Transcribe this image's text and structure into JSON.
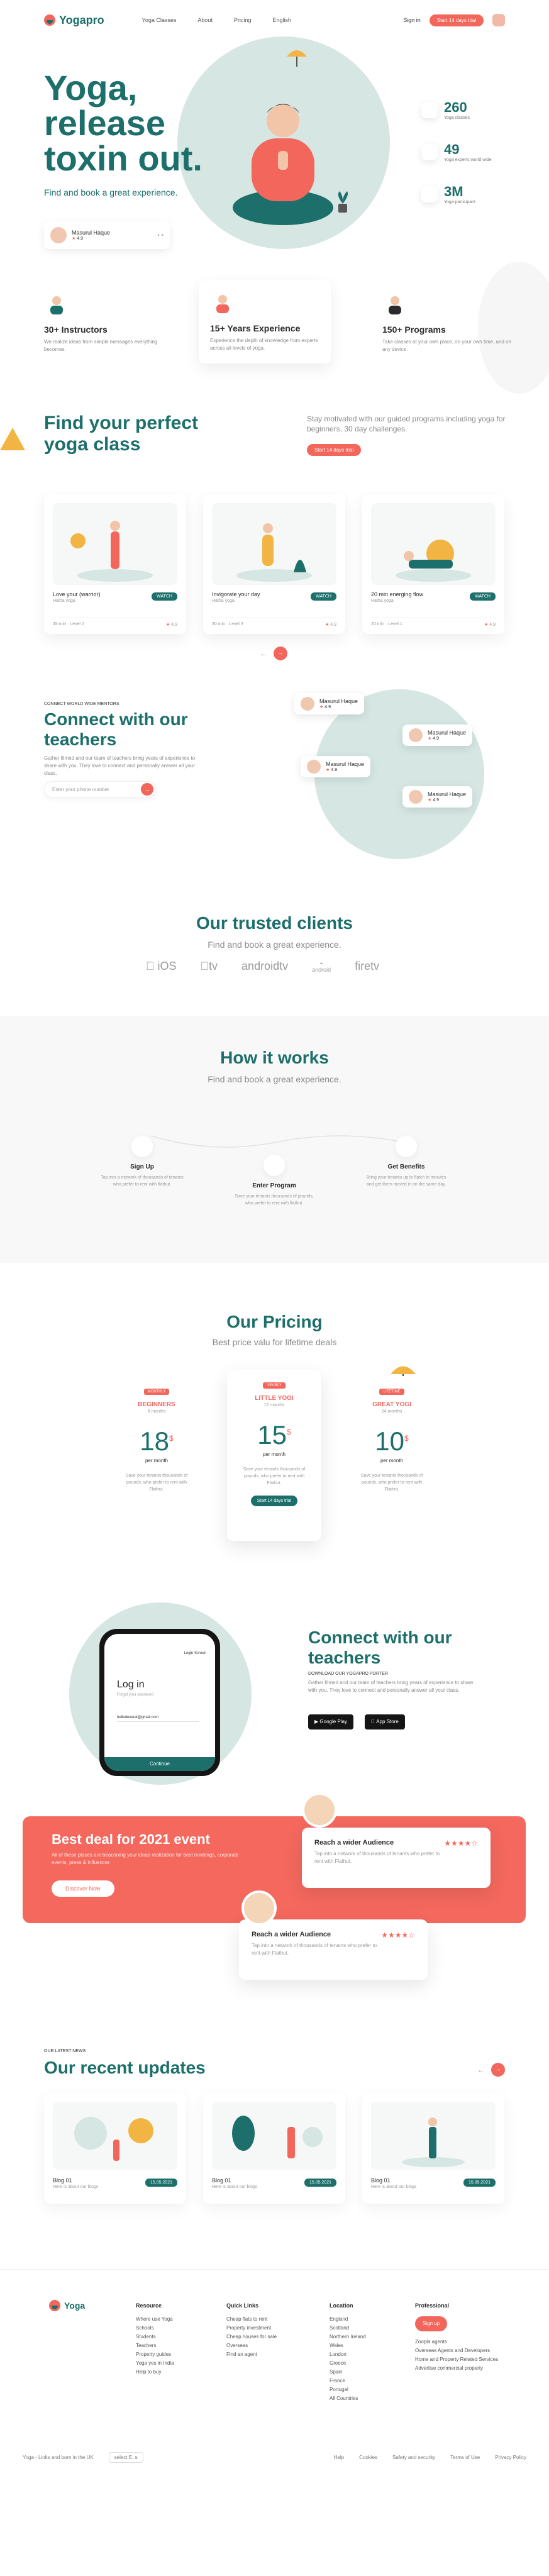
{
  "nav": {
    "brand": "Yogapro",
    "links": [
      "Yoga Classes",
      "About",
      "Pricing",
      "English"
    ],
    "signin": "Sign in",
    "signup": "Start 14 days trial"
  },
  "hero": {
    "title": "Yoga, release toxin out.",
    "subtitle": "Find and book a great experience.",
    "card_name": "Masurul Haque",
    "card_rating": "4.9",
    "stats": [
      {
        "num": "260",
        "label": "Yoga classes"
      },
      {
        "num": "49",
        "label": "Yoga experts world wide"
      },
      {
        "num": "3M",
        "label": "Yoga participant"
      }
    ]
  },
  "features": [
    {
      "title": "30+ Instructors",
      "text": "We realize ideas from simple messages everything becomes."
    },
    {
      "title": "15+ Years Experience",
      "text": "Experience the depth of knowledge from experts across all levels of yoga."
    },
    {
      "title": "150+ Programs",
      "text": "Take classes at your own place, on your own time, and on any device."
    }
  ],
  "classes": {
    "title": "Find your perfect yoga class",
    "desc": "Stay motivated with our guided programs including yoga for beginners, 30 day challenges.",
    "cta": "Start 14 days trial",
    "cards": [
      {
        "title": "Love your (warrior)",
        "sub": "Hatha yoga",
        "btn": "WATCH",
        "meta": "45 min · Level 2",
        "rating": "4.9"
      },
      {
        "title": "Invigorate your day",
        "sub": "Hatha yoga",
        "btn": "WATCH",
        "meta": "30 min · Level 3",
        "rating": "4.9"
      },
      {
        "title": "20 min energing flow",
        "sub": "Hatha yoga",
        "btn": "WATCH",
        "meta": "20 min · Level 1",
        "rating": "4.9"
      }
    ]
  },
  "teachers": {
    "kicker": "CONNECT WORLD WIDE MENTORS",
    "title": "Connect with our teachers",
    "text": "Gather filmed and our team of teachers bring years of experience to share with you. They love to connect and personally answer all your class.",
    "placeholder": "Enter your phone number",
    "people": [
      {
        "name": "Masurul Haque",
        "rating": "4.9"
      },
      {
        "name": "Masurul Haque",
        "rating": "4.9"
      },
      {
        "name": "Masurul Haque",
        "rating": "4.9"
      },
      {
        "name": "Masurul Haque",
        "rating": "4.9"
      }
    ]
  },
  "clients": {
    "title": "Our trusted clients",
    "subtitle": "Find and book a great experience.",
    "logos": [
      "iOS",
      "tv",
      "androidtv",
      "android",
      "firetv"
    ]
  },
  "how": {
    "title": "How it works",
    "subtitle": "Find and book a great experience.",
    "steps": [
      {
        "title": "Sign Up",
        "text": "Tap into a network of thousands of tenants who prefer to rent with flathut."
      },
      {
        "title": "Enter Program",
        "text": "Save your tenants thousands of pounds, who prefer to rent with flathut."
      },
      {
        "title": "Get Benefits",
        "text": "Bring your tenants up to flatch in minutes and get them moved in on the same day."
      }
    ]
  },
  "pricing": {
    "title": "Our Pricing",
    "subtitle": "Best price valu for lifetime deals",
    "plans": [
      {
        "tag": "MONTHLY",
        "name": "BEGINNERS",
        "period": "6 months",
        "price": "18",
        "per": "per month",
        "text": "Save your tenants thousands of pounds, who prefer to rent with Flathut."
      },
      {
        "tag": "YEARLY",
        "name": "LITTLE YOGI",
        "period": "12 months",
        "price": "15",
        "per": "per month",
        "text": "Save your tenants thousands of pounds, who prefer to rent with Flathut.",
        "btn": "Start 14 days trial"
      },
      {
        "tag": "LIFETIME",
        "name": "GREAT YOGI",
        "period": "24 months",
        "price": "10",
        "per": "per month",
        "text": "Save your tenants thousands of pounds, who prefer to rent with Flathut."
      }
    ],
    "currency": "$"
  },
  "app": {
    "title": "Connect with our teachers",
    "kicker": "DOWNLOAD OUR YOGAPRO PORTER",
    "text": "Gather filmed and our team of teachers bring years of experience to share with you. They love to connect and personally answer all your class.",
    "google": "Google Play",
    "apple": "App Store",
    "phone": {
      "top": "Login Screen",
      "title": "Log in",
      "prompt": "Forgot your password",
      "email": "hellodeverat@gmail.com",
      "btn": "Continue"
    }
  },
  "deal": {
    "title": "Best deal for 2021 event",
    "text": "All of these places are beaconing your ideas realization for best meetings, corporate events, press & influencer.",
    "btn": "Discover Now",
    "cards": [
      {
        "title": "Reach a wider Audience",
        "text": "Tap into a network of thousands of tenants who prefer to rent with Flathut."
      },
      {
        "title": "Reach a wider Audience",
        "text": "Tap into a network of thousands of tenants who prefer to rent with Flathut."
      }
    ]
  },
  "updates": {
    "kicker": "OUR LATEST NEWS",
    "title": "Our recent updates",
    "posts": [
      {
        "title": "Blog 01",
        "sub": "Here is about our blogs",
        "date": "15.05.2021"
      },
      {
        "title": "Blog 01",
        "sub": "Here is about our blogs",
        "date": "15.05.2021"
      },
      {
        "title": "Blog 01",
        "sub": "Here is about our blogs",
        "date": "15.05.2021"
      }
    ]
  },
  "footer": {
    "brand": "Yoga",
    "cols": [
      {
        "title": "Resource",
        "items": [
          "Where use Yoga",
          "Schools",
          "Students",
          "Teachers",
          "Property guides",
          "Yoga yes in India",
          "Help to buy"
        ]
      },
      {
        "title": "Quick Links",
        "items": [
          "Cheap flats to rent",
          "Property investment",
          "Cheap houses for sale",
          "Overseas",
          "Find an agent"
        ]
      },
      {
        "title": "Location",
        "items": [
          "England",
          "Scotland",
          "Northern Ireland",
          "Wales",
          "London",
          "Greece",
          "Spain",
          "France",
          "Portugal",
          "All Countries"
        ]
      },
      {
        "title": "Professional",
        "items": [
          "Zoopla agents",
          "Overseas Agents and Developers",
          "Home and Property Related Services",
          "Advertise commercial property"
        ]
      }
    ],
    "pro_btn": "Sign up",
    "copyright": "Yoga - Links and born in the UK",
    "lang": "select E. s",
    "links": [
      "Help",
      "Cookies",
      "Safety and security",
      "Terms of Use",
      "Privacy Policy"
    ]
  }
}
